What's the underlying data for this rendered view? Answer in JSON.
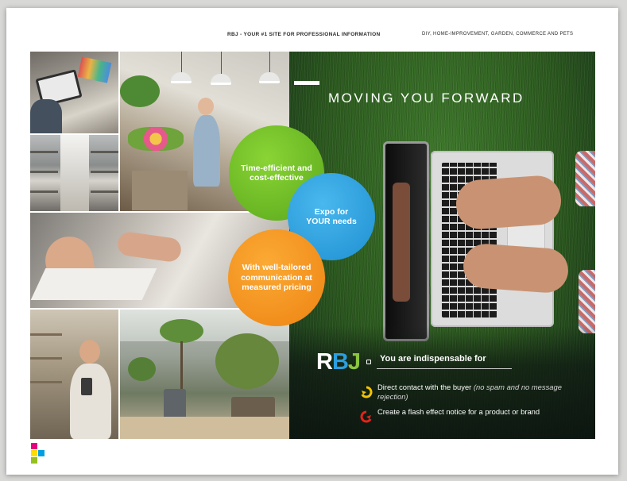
{
  "header": {
    "tagline": "RBJ - YOUR #1 SITE FOR PROFESSIONAL INFORMATION",
    "sectors": "DIY, HOME-IMPROVEMENT, GARDEN, COMMERCE AND PETS"
  },
  "hero": {
    "headline": "MOVING YOU FORWARD"
  },
  "bubbles": {
    "green": "Time-efficient and cost-effective",
    "blue_line1": "Expo for",
    "blue_line2": "YOUR needs",
    "orange": "With well-tailored communication at measured pricing"
  },
  "brand": {
    "logo_r": "R",
    "logo_b": "B",
    "logo_j": "J",
    "indispensable": "You are indispensable for"
  },
  "benefits": {
    "item1_main": "Direct contact with the buyer",
    "item1_note": "(no spam and no message rejection)",
    "item2": "Create a flash effect notice for a product or brand"
  },
  "colors": {
    "green": "#6cc02a",
    "blue": "#2a9fe0",
    "orange": "#f39325",
    "bullet_yellow": "#f4c400",
    "bullet_red": "#e2231a",
    "mosaic_pink": "#e6007e",
    "mosaic_yellow": "#ffdd00",
    "mosaic_blue": "#009fe3",
    "mosaic_green": "#95c11f"
  }
}
